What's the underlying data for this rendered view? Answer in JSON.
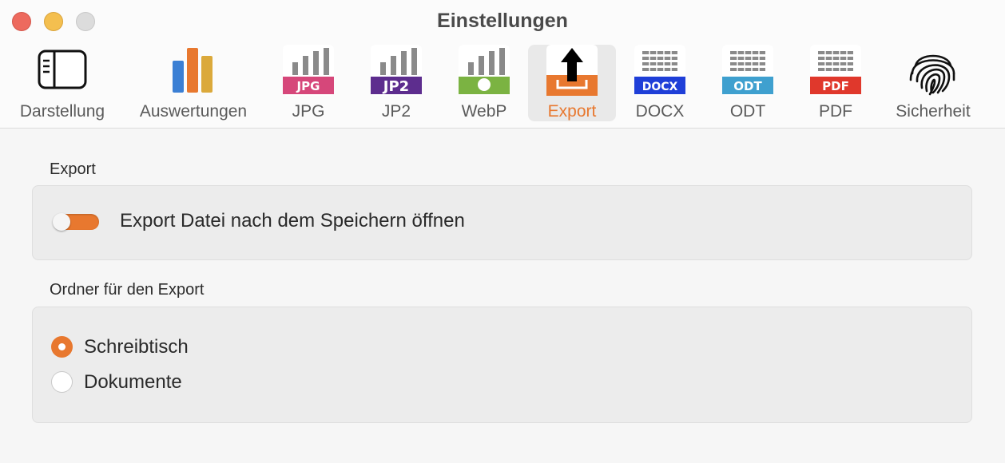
{
  "window": {
    "title": "Einstellungen"
  },
  "toolbar": {
    "tabs": [
      {
        "label": "Darstellung"
      },
      {
        "label": "Auswertungen"
      },
      {
        "label": "JPG",
        "badge": "JPG",
        "color": "#d6477a"
      },
      {
        "label": "JP2",
        "badge": "JP2",
        "color": "#5d2d8e"
      },
      {
        "label": "WebP",
        "color": "#7bb342"
      },
      {
        "label": "Export",
        "selected": true,
        "color": "#e8782f"
      },
      {
        "label": "DOCX",
        "badge": "DOCX",
        "color": "#1f3fd8"
      },
      {
        "label": "ODT",
        "badge": "ODT",
        "color": "#3fa0cf"
      },
      {
        "label": "PDF",
        "badge": "PDF",
        "color": "#e0382c"
      },
      {
        "label": "Sicherheit"
      }
    ]
  },
  "export_section": {
    "title": "Export",
    "toggle_label": "Export Datei nach dem Speichern öffnen",
    "toggle_on": false
  },
  "folder_section": {
    "title": "Ordner für den Export",
    "options": [
      {
        "label": "Schreibtisch",
        "selected": true
      },
      {
        "label": "Dokumente",
        "selected": false
      }
    ]
  },
  "colors": {
    "accent": "#e8782f"
  }
}
